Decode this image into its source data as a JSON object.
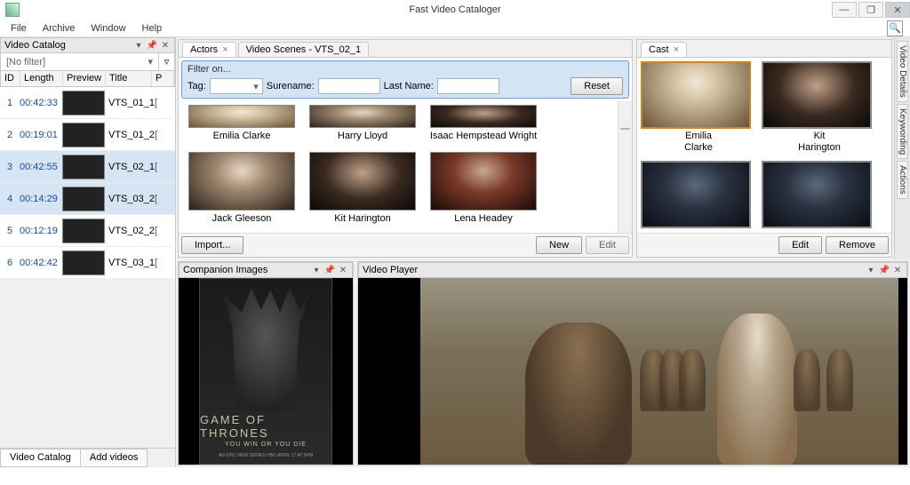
{
  "app_title": "Fast Video Cataloger",
  "menu": {
    "file": "File",
    "archive": "Archive",
    "window": "Window",
    "help": "Help"
  },
  "left": {
    "panel_title": "Video Catalog",
    "filter_text": "[No filter]",
    "columns": {
      "id": "ID",
      "length": "Length",
      "preview": "Preview",
      "title": "Title",
      "p": "P"
    },
    "rows": [
      {
        "id": "1",
        "len": "00:42:33",
        "title": "VTS_01_1",
        "p": "["
      },
      {
        "id": "2",
        "len": "00:19:01",
        "title": "VTS_01_2",
        "p": "["
      },
      {
        "id": "3",
        "len": "00:42:55",
        "title": "VTS_02_1",
        "p": "["
      },
      {
        "id": "4",
        "len": "00:14:29",
        "title": "VTS_03_2",
        "p": "["
      },
      {
        "id": "5",
        "len": "00:12:19",
        "title": "VTS_02_2",
        "p": "["
      },
      {
        "id": "6",
        "len": "00:42:42",
        "title": "VTS_03_1",
        "p": "["
      }
    ],
    "tabs": {
      "catalog": "Video Catalog",
      "add": "Add videos"
    }
  },
  "actors": {
    "tab1": "Actors",
    "tab2": "Video Scenes - VTS_02_1",
    "filter_label": "Filter on...",
    "tag": "Tag:",
    "surename": "Surename:",
    "lastname": "Last Name:",
    "reset": "Reset",
    "list": [
      "Emilia Clarke",
      "Harry Lloyd",
      "Isaac Hempstead Wright",
      "Jack Gleeson",
      "Kit Harington",
      "Lena Headey"
    ],
    "import": "Import...",
    "new": "New",
    "edit": "Edit"
  },
  "cast": {
    "title": "Cast",
    "people": [
      {
        "first": "Emilia",
        "last": "Clarke"
      },
      {
        "first": "Kit",
        "last": "Harington"
      }
    ],
    "edit": "Edit",
    "remove": "Remove"
  },
  "side_tabs": {
    "details": "Video Details",
    "keywording": "Keywording",
    "actions": "Actions"
  },
  "companion": {
    "title": "Companion Images",
    "poster_title": "GAME OF THRONES",
    "poster_sub": "YOU WIN OR YOU DIE",
    "poster_sub2": "AN EPIC NEW SERIES   HBO   APRIL 17 AT 9PM"
  },
  "player": {
    "title": "Video Player"
  }
}
